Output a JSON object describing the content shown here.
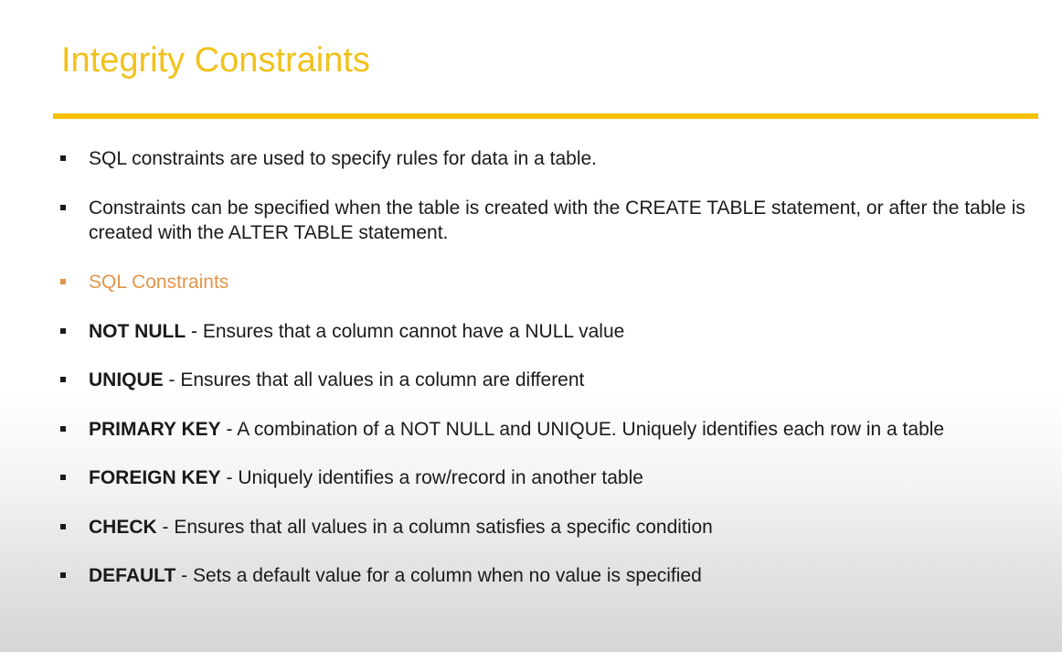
{
  "slide": {
    "title": "Integrity Constraints",
    "accent_color": "#f5c000",
    "subheading_color": "#e2954a"
  },
  "intro": [
    {
      "text": "SQL constraints are used to specify rules for data in a table."
    },
    {
      "text": "Constraints can be specified when the table is created with the CREATE TABLE statement, or after the table is created with the ALTER TABLE statement."
    }
  ],
  "subheading": "SQL Constraints",
  "constraints": [
    {
      "term": "NOT NULL",
      "desc": " - Ensures that a column cannot have a NULL value"
    },
    {
      "term": "UNIQUE",
      "desc": " - Ensures that all values in a column are different"
    },
    {
      "term": "PRIMARY KEY",
      "desc": " - A combination of a NOT NULL and UNIQUE. Uniquely identifies each row in a table"
    },
    {
      "term": "FOREIGN KEY",
      "desc": " - Uniquely identifies a row/record in another table"
    },
    {
      "term": "CHECK",
      "desc": " - Ensures that all values in a column satisfies a specific condition"
    },
    {
      "term": "DEFAULT",
      "desc": " - Sets a default value for a column when no value is specified"
    }
  ]
}
